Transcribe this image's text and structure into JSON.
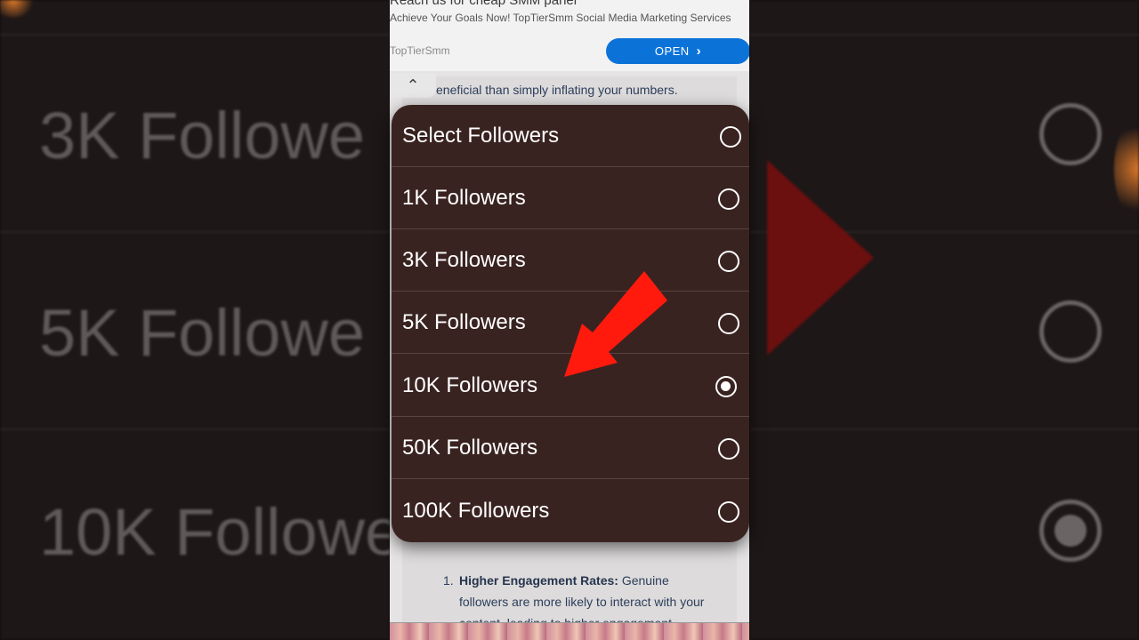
{
  "background": {
    "left_labels": [
      "3K Followe",
      "5K Followe",
      "10K Followe"
    ]
  },
  "ad": {
    "title": "Reach us for cheap SMM panel",
    "description": "Achieve Your Goals Now! TopTierSmm Social Media Marketing Services",
    "brand": "TopTierSmm",
    "open_label": "OPEN",
    "open_icon": "chevron-right-icon"
  },
  "article": {
    "collapse_icon": "chevron-up-icon",
    "snippet": "eneficial than simply inflating your numbers.",
    "list_item_number": "1.",
    "list_item_title": "Higher Engagement Rates",
    "list_item_text": "Genuine followers are more likely to interact with your content, leading to higher engagement"
  },
  "dropdown": {
    "options": [
      {
        "label": "Select Followers",
        "selected": false
      },
      {
        "label": "1K Followers",
        "selected": false
      },
      {
        "label": "3K Followers",
        "selected": false
      },
      {
        "label": "5K Followers",
        "selected": false
      },
      {
        "label": "10K Followers",
        "selected": true
      },
      {
        "label": "50K Followers",
        "selected": false
      },
      {
        "label": "100K Followers",
        "selected": false
      }
    ]
  },
  "colors": {
    "sheet_bg": "#392320",
    "open_button": "#0b73d8",
    "annotation_arrow": "#ff1a0d"
  }
}
